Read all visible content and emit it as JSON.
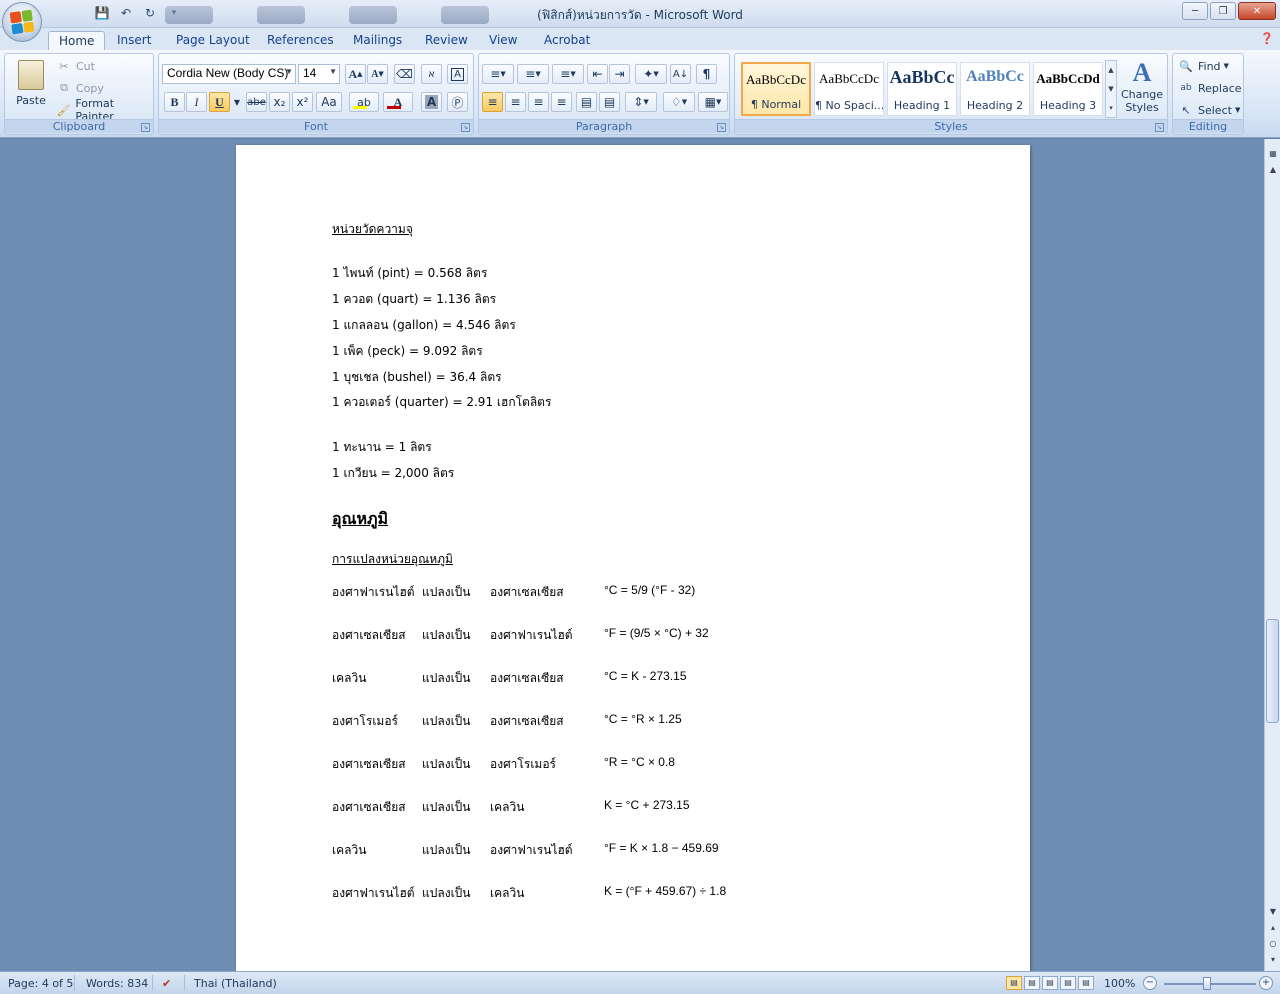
{
  "window": {
    "title": "(ฟิสิกส์)หน่วยการวัด - Microsoft Word"
  },
  "tabs": [
    "Home",
    "Insert",
    "Page Layout",
    "References",
    "Mailings",
    "Review",
    "View",
    "Acrobat"
  ],
  "clipboard": {
    "paste": "Paste",
    "cut": "Cut",
    "copy": "Copy",
    "format_painter": "Format Painter",
    "label": "Clipboard"
  },
  "font": {
    "name": "Cordia New (Body CS)",
    "size": "14",
    "label": "Font",
    "bold": "B",
    "italic": "I",
    "underline": "U",
    "strike": "abe",
    "sub": "x₂",
    "sup": "x²",
    "case": "Aa",
    "grow": "A",
    "shrink": "A",
    "highlight_color": "#ffff00",
    "font_color": "#c00000"
  },
  "paragraph": {
    "label": "Paragraph",
    "pilcrow": "¶"
  },
  "styles": {
    "label": "Styles",
    "items": [
      {
        "sample": "AaBbCcDc",
        "name": "¶ Normal"
      },
      {
        "sample": "AaBbCcDc",
        "name": "¶ No Spaci..."
      },
      {
        "sample": "AaBbCc",
        "name": "Heading 1"
      },
      {
        "sample": "AaBbCc",
        "name": "Heading 2"
      },
      {
        "sample": "AaBbCcDd",
        "name": "Heading 3"
      }
    ],
    "change_styles": "Change Styles"
  },
  "editing": {
    "label": "Editing",
    "find": "Find",
    "replace": "Replace",
    "select": "Select"
  },
  "document": {
    "volume_heading": "หน่วยวัดความจุ",
    "volume_lines": [
      "1 ไพนท์ (pint) = 0.568 ลิตร",
      "1 ควอต (quart) = 1.136 ลิตร",
      "1 แกลลอน (gallon) = 4.546 ลิตร",
      "1 เพ็ค (peck) = 9.092 ลิตร",
      "1 บุชเชล (bushel) = 36.4 ลิตร",
      "1 ควอเตอร์ (quarter) = 2.91 เฮกโตลิตร"
    ],
    "thai_lines": [
      "1 ทะนาน = 1 ลิตร",
      "1 เกวียน = 2,000 ลิตร"
    ],
    "temp_heading": "อุณหภูมิ",
    "temp_subheading": "การแปลงหน่วยอุณหภูมิ",
    "conversions": [
      {
        "from": "องศาฟาเรนไฮต์",
        "verb": "แปลงเป็น",
        "to": "องศาเซลเซียส",
        "formula": "°C = 5/9 (°F - 32)"
      },
      {
        "from": "องศาเซลเซียส",
        "verb": "แปลงเป็น",
        "to": "องศาฟาเรนไฮต์",
        "formula": "°F = (9/5 × °C) + 32"
      },
      {
        "from": "เคลวิน",
        "verb": "แปลงเป็น",
        "to": "องศาเซลเซียส",
        "formula": "°C = K - 273.15"
      },
      {
        "from": "องศาโรเมอร์",
        "verb": "แปลงเป็น",
        "to": "องศาเซลเซียส",
        "formula": "°C = °R × 1.25"
      },
      {
        "from": "องศาเซลเซียส",
        "verb": "แปลงเป็น",
        "to": "องศาโรเมอร์",
        "formula": "°R = °C × 0.8"
      },
      {
        "from": "องศาเซลเซียส",
        "verb": "แปลงเป็น",
        "to": "เคลวิน",
        "formula": "K = °C + 273.15"
      },
      {
        "from": "เคลวิน",
        "verb": "แปลงเป็น",
        "to": "องศาฟาเรนไฮต์",
        "formula": "°F = K × 1.8 − 459.69"
      },
      {
        "from": "องศาฟาเรนไฮต์",
        "verb": "แปลงเป็น",
        "to": "เคลวิน",
        "formula": "K = (°F + 459.67) ÷ 1.8"
      }
    ]
  },
  "status": {
    "page": "Page: 4 of 5",
    "words": "Words: 834",
    "language": "Thai (Thailand)",
    "zoom": "100%",
    "zoom_level_percent": 100
  }
}
